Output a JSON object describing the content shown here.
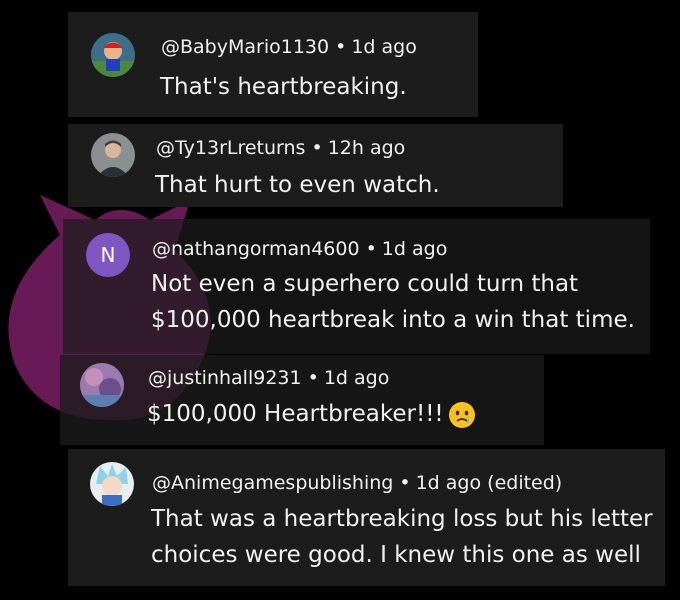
{
  "comments": [
    {
      "username": "@BabyMario1130",
      "time": "1d ago",
      "edited": "",
      "lines": [
        "That's heartbreaking."
      ],
      "avatar": "mario-avatar"
    },
    {
      "username": "@Ty13rLreturns",
      "time": "12h ago",
      "edited": "",
      "lines": [
        "That hurt to even watch."
      ],
      "avatar": "photo-avatar"
    },
    {
      "username": "@nathangorman4600",
      "time": "1d ago",
      "edited": "",
      "avatar_letter": "N",
      "lines": [
        "Not even a superhero could turn that",
        "$100,000 heartbreak into a win that time."
      ],
      "avatar": "letter-avatar"
    },
    {
      "username": "@justinhall9231",
      "time": "1d ago",
      "edited": "",
      "lines": [
        "$100,000 Heartbreaker!!!"
      ],
      "emoji": "crying-face-emoji",
      "avatar": "art-avatar"
    },
    {
      "username": "@Animegamespublishing",
      "time": "1d ago",
      "edited": "(edited)",
      "lines": [
        "That was a heartbreaking loss but his letter",
        "choices were good. I knew this one as well"
      ],
      "avatar": "anime-avatar"
    }
  ],
  "colors": {
    "card_bg": "#1c1c1c",
    "page_bg": "#000000",
    "letter_avatar_bg": "#7e57c2",
    "mascot": "#7a1f66"
  }
}
